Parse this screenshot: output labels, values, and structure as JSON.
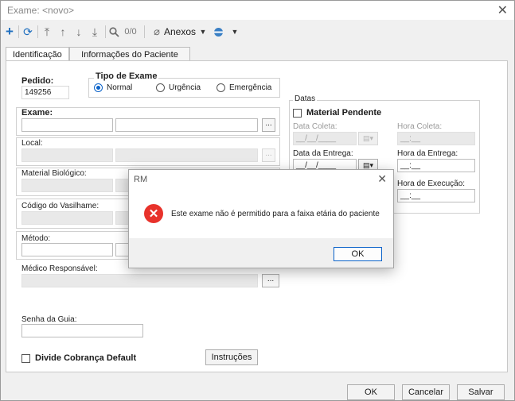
{
  "window": {
    "title": "Exame: <novo>",
    "close": "✕"
  },
  "toolbar": {
    "anexos": "Anexos",
    "count": "0/0"
  },
  "tabs": [
    "Identificação",
    "Informações do Paciente"
  ],
  "form": {
    "pedido_label": "Pedido:",
    "pedido_value": "149256",
    "tipo_exame_label": "Tipo de Exame",
    "tipo_options": [
      "Normal",
      "Urgência",
      "Emergência"
    ],
    "exame_label": "Exame:",
    "local_label": "Local:",
    "material_label": "Material Biológico:",
    "vasilhame_label": "Código do Vasilhame:",
    "metodo_label": "Método:",
    "medico_label": "Médico Responsável:",
    "senha_label": "Senha da Guia:",
    "divide_label": "Divide Cobrança Default",
    "instrucoes": "Instruções",
    "dots": "..."
  },
  "datas": {
    "group_label": "Datas",
    "material_pendente": "Material Pendente",
    "data_coleta_label": "Data Coleta:",
    "data_coleta_value": "__/__/____",
    "hora_coleta_label": "Hora Coleta:",
    "hora_coleta_value": "__:__",
    "data_entrega_label": "Data da Entrega:",
    "data_entrega_value": "__/__/____",
    "hora_entrega_label": "Hora da Entrega:",
    "hora_entrega_value": "__:__",
    "hora_execucao_label": "Hora de Execução:",
    "hora_execucao_value": "__:__"
  },
  "footer": {
    "ok": "OK",
    "cancel": "Cancelar",
    "save": "Salvar"
  },
  "dialog": {
    "title": "RM",
    "close": "✕",
    "message": "Este exame não é permitido para a faixa etária do paciente",
    "ok": "OK"
  }
}
